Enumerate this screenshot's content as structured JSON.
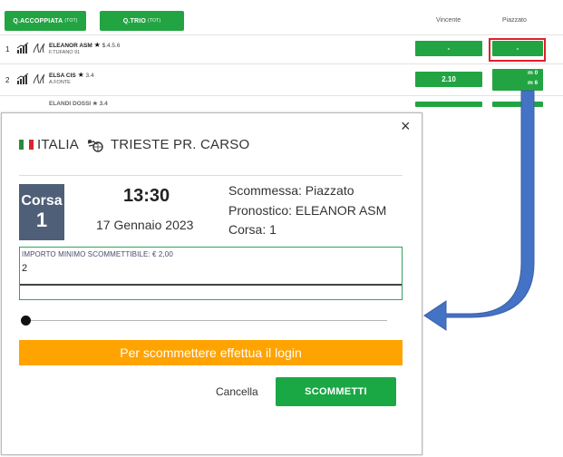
{
  "table": {
    "buttons": [
      {
        "label": "Q.ACCOPPIATA",
        "suffix": "(TOT)"
      },
      {
        "label": "Q.TRIO",
        "suffix": "(TOT)"
      }
    ],
    "columns": {
      "vincente": "Vincente",
      "piazzato": "Piazzato"
    },
    "rows": [
      {
        "number": "1",
        "horse": "ELEANOR ASM",
        "star": "★",
        "performance": "$.4.5.6",
        "jockey": "F.TUFANO 91",
        "win_odd": "-",
        "place_odd": "-"
      },
      {
        "number": "2",
        "horse": "ELSA CIS",
        "star": "★",
        "performance": "3.4",
        "jockey": "A.FONTE",
        "win_odd": "2.10",
        "place_odd_min": "m 0",
        "place_odd_max": "m 6"
      }
    ],
    "partial_row": "ELANDI DOSSI ★ 3.4"
  },
  "modal": {
    "close_symbol": "×",
    "country": "ITALIA",
    "venue": "TRIESTE PR. CARSO",
    "flag_colors": [
      "#2b8a3e",
      "#ffffff",
      "#d7262e"
    ],
    "race_label": "Corsa",
    "race_number": "1",
    "time": "13:30",
    "date": "17 Gennaio 2023",
    "bet_line": "Scommessa: Piazzato",
    "prediction_line": "Pronostico: ELEANOR ASM",
    "race_line": "Corsa: 1",
    "amount_label": "IMPORTO MINIMO SCOMMETTIBILE: € 2,00",
    "amount_value": "2",
    "slider_value": 0,
    "login_text": "Per scommettere effettua il login",
    "cancel_label": "Cancella",
    "submit_label": "SCOMMETTI"
  },
  "colors": {
    "green": "#22a443",
    "orange": "#ffa300",
    "badge": "#4f5f77",
    "highlight": "#e0202a",
    "arrow": "#4472c4"
  }
}
